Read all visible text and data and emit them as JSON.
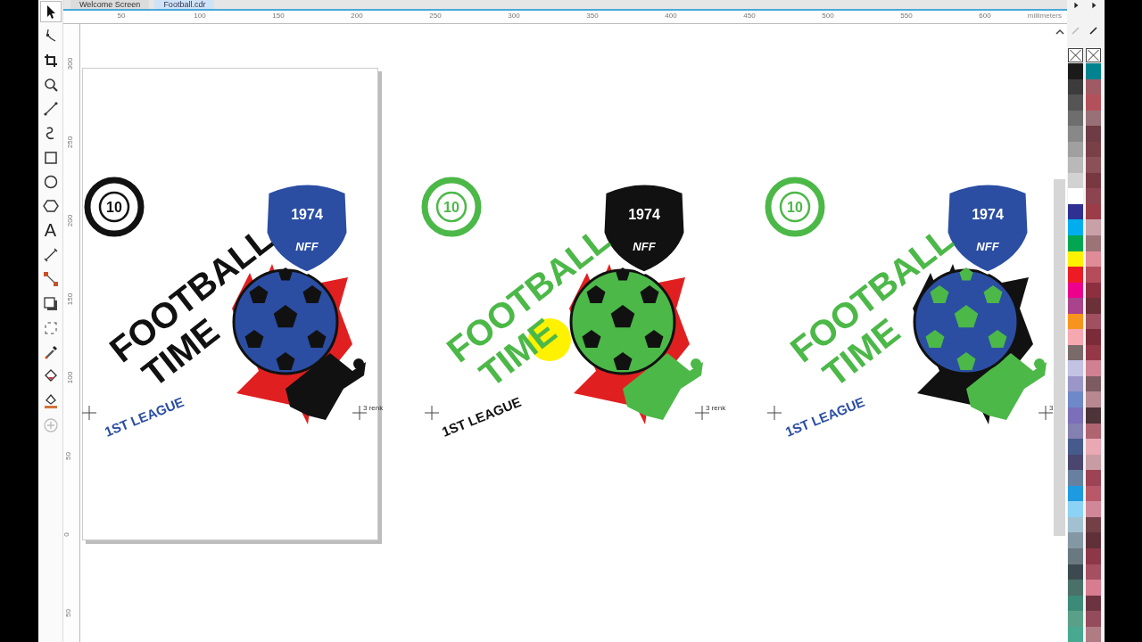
{
  "tabs": [
    {
      "label": "Welcome Screen",
      "selected": false
    },
    {
      "label": "Football.cdr",
      "selected": true
    }
  ],
  "toolbox": [
    {
      "kind": "pick",
      "selected": true
    },
    {
      "kind": "shape",
      "selected": false
    },
    {
      "kind": "crop",
      "selected": false
    },
    {
      "kind": "zoom",
      "selected": false
    },
    {
      "kind": "line",
      "selected": false
    },
    {
      "kind": "curve",
      "selected": false
    },
    {
      "kind": "rect",
      "selected": false
    },
    {
      "kind": "ellipse",
      "selected": false
    },
    {
      "kind": "polygon",
      "selected": false
    },
    {
      "kind": "text",
      "label": "A",
      "selected": false
    },
    {
      "kind": "dimension",
      "selected": false
    },
    {
      "kind": "connector",
      "selected": false
    },
    {
      "kind": "shadow",
      "selected": false
    },
    {
      "kind": "transparency",
      "selected": false
    },
    {
      "kind": "eyedropper",
      "selected": false
    },
    {
      "kind": "fill",
      "selected": false
    },
    {
      "kind": "outline",
      "selected": false
    },
    {
      "kind": "add",
      "selected": false
    }
  ],
  "horizontal_ruler": {
    "labels": [
      "50",
      "100",
      "150",
      "200",
      "250",
      "300",
      "350",
      "400",
      "450",
      "500",
      "550",
      "600"
    ],
    "unit": "millimeters"
  },
  "vertical_ruler": {
    "labels": [
      "300",
      "250",
      "200",
      "150",
      "100",
      "50",
      "0",
      "50"
    ]
  },
  "designs": [
    {
      "title_top": "FOOTBALL",
      "title_bottom": "TIME",
      "badge_number": "10",
      "shield_year": "1974",
      "shield_initials": "NFF",
      "league": "1ST LEAGUE",
      "kind": "black",
      "highlight": false
    },
    {
      "title_top": "FOOTBALL",
      "title_bottom": "TIME",
      "badge_number": "10",
      "shield_year": "1974",
      "shield_initials": "NFF",
      "league": "1ST LEAGUE",
      "kind": "green",
      "highlight": true
    },
    {
      "title_top": "FOOTBALL",
      "title_bottom": "TIME",
      "badge_number": "10",
      "shield_year": "1974",
      "shield_initials": "NFF",
      "league": "1ST LEAGUE",
      "kind": "greenblue",
      "highlight": false
    }
  ],
  "markers": [
    {
      "label": "3 renk"
    },
    {
      "label": "3 renk"
    },
    {
      "label": "3"
    }
  ],
  "palettes": [
    {
      "swatches": [
        {
          "color": "#1a1a1a"
        },
        {
          "color": "#3c3c3c"
        },
        {
          "color": "#555555"
        },
        {
          "color": "#6e6e6e"
        },
        {
          "color": "#888888"
        },
        {
          "color": "#a0a0a0"
        },
        {
          "color": "#b9b9b9"
        },
        {
          "color": "#d2d2d2"
        },
        {
          "color": "#ffffff"
        },
        {
          "color": "#2e3192"
        },
        {
          "color": "#00aeef"
        },
        {
          "color": "#00a651"
        },
        {
          "color": "#fff200"
        },
        {
          "color": "#ed1c24"
        },
        {
          "color": "#ec008c"
        },
        {
          "color": "#a8438c"
        },
        {
          "color": "#f7941d"
        },
        {
          "color": "#f6a8b0"
        },
        {
          "color": "#7b6a6a"
        },
        {
          "color": "#c4c2e2"
        },
        {
          "color": "#9a96c8"
        },
        {
          "color": "#6f88c8"
        },
        {
          "color": "#7a6fb8"
        },
        {
          "color": "#8480b0"
        },
        {
          "color": "#465a8c"
        },
        {
          "color": "#4a4670"
        },
        {
          "color": "#6880a0"
        },
        {
          "color": "#1e9ae0"
        },
        {
          "color": "#8cd2f4"
        },
        {
          "color": "#a2c0d0"
        },
        {
          "color": "#8498a4"
        },
        {
          "color": "#6a7880"
        },
        {
          "color": "#3c4a50"
        },
        {
          "color": "#4a7068"
        },
        {
          "color": "#3c8a78"
        },
        {
          "color": "#5aa088"
        },
        {
          "color": "#48a890"
        }
      ]
    },
    {
      "swatches": [
        {
          "color": "#00838f"
        },
        {
          "color": "#a05a64"
        },
        {
          "color": "#b4505a"
        },
        {
          "color": "#987078"
        },
        {
          "color": "#6e3c44"
        },
        {
          "color": "#7a4048"
        },
        {
          "color": "#8c5058"
        },
        {
          "color": "#783840"
        },
        {
          "color": "#8c4450"
        },
        {
          "color": "#9c3c48"
        },
        {
          "color": "#c8a0a8"
        },
        {
          "color": "#9c7478"
        },
        {
          "color": "#e08c98"
        },
        {
          "color": "#b44c5a"
        },
        {
          "color": "#8c3040"
        },
        {
          "color": "#6c3038"
        },
        {
          "color": "#a05060"
        },
        {
          "color": "#7c2c38"
        },
        {
          "color": "#943848"
        },
        {
          "color": "#d08090"
        },
        {
          "color": "#7c5c60"
        },
        {
          "color": "#b88890"
        },
        {
          "color": "#4c3438"
        },
        {
          "color": "#b06470"
        },
        {
          "color": "#e8a8b4"
        },
        {
          "color": "#c89ca4"
        },
        {
          "color": "#9c4454"
        },
        {
          "color": "#b85868"
        },
        {
          "color": "#d08898"
        },
        {
          "color": "#744048"
        },
        {
          "color": "#603038"
        },
        {
          "color": "#8c3848"
        },
        {
          "color": "#a45060"
        },
        {
          "color": "#d87c90"
        },
        {
          "color": "#6c3440"
        },
        {
          "color": "#944c5c"
        },
        {
          "color": "#b07c84"
        }
      ]
    }
  ]
}
